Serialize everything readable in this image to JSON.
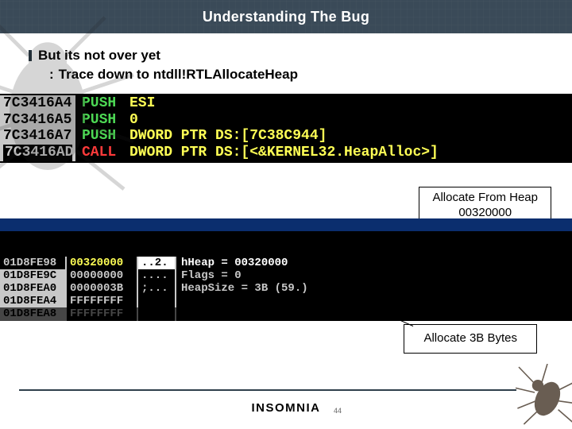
{
  "header": {
    "title": "Understanding The Bug"
  },
  "bullets": {
    "main": "But its not over yet",
    "sub": "Trace down to ntdll!RTLAllocateHeap"
  },
  "disasm": [
    {
      "addr": "7C3416A4",
      "mnem": "PUSH",
      "mnemClass": "push",
      "oper": "ESI",
      "hl": false
    },
    {
      "addr": "7C3416A5",
      "mnem": "PUSH",
      "mnemClass": "push",
      "oper": "0",
      "hl": false
    },
    {
      "addr": "7C3416A7",
      "mnem": "PUSH",
      "mnemClass": "push",
      "oper": "DWORD PTR DS:[7C38C944]",
      "hl": false
    },
    {
      "addr": "7C3416AD",
      "mnem": "CALL",
      "mnemClass": "call",
      "oper": "DWORD PTR DS:[<&KERNEL32.HeapAlloc>]",
      "hl": true
    }
  ],
  "callouts": {
    "heap": {
      "line1": "Allocate From Heap",
      "line2": "00320000"
    },
    "bytes": {
      "line1": "Allocate 3B Bytes"
    }
  },
  "stack": [
    {
      "addr": "01D8FE98",
      "val": "00320000",
      "asc": "..2.",
      "sym": "hHeap = 00320000",
      "sel": true
    },
    {
      "addr": "01D8FE9C",
      "val": "00000000",
      "asc": "....",
      "sym": "Flags = 0",
      "sel": false
    },
    {
      "addr": "01D8FEA0",
      "val": "0000003B",
      "asc": ";...",
      "sym": "HeapSize = 3B (59.)",
      "sel": false
    },
    {
      "addr": "01D8FEA4",
      "val": "FFFFFFFF",
      "asc": "",
      "sym": "",
      "sel": false
    },
    {
      "addr": "01D8FEA8",
      "val": "FFFFFFFF",
      "asc": "",
      "sym": "",
      "sel": false,
      "faded": true
    }
  ],
  "footer": {
    "brand": "INSOMNIA",
    "pagenum": "44"
  }
}
